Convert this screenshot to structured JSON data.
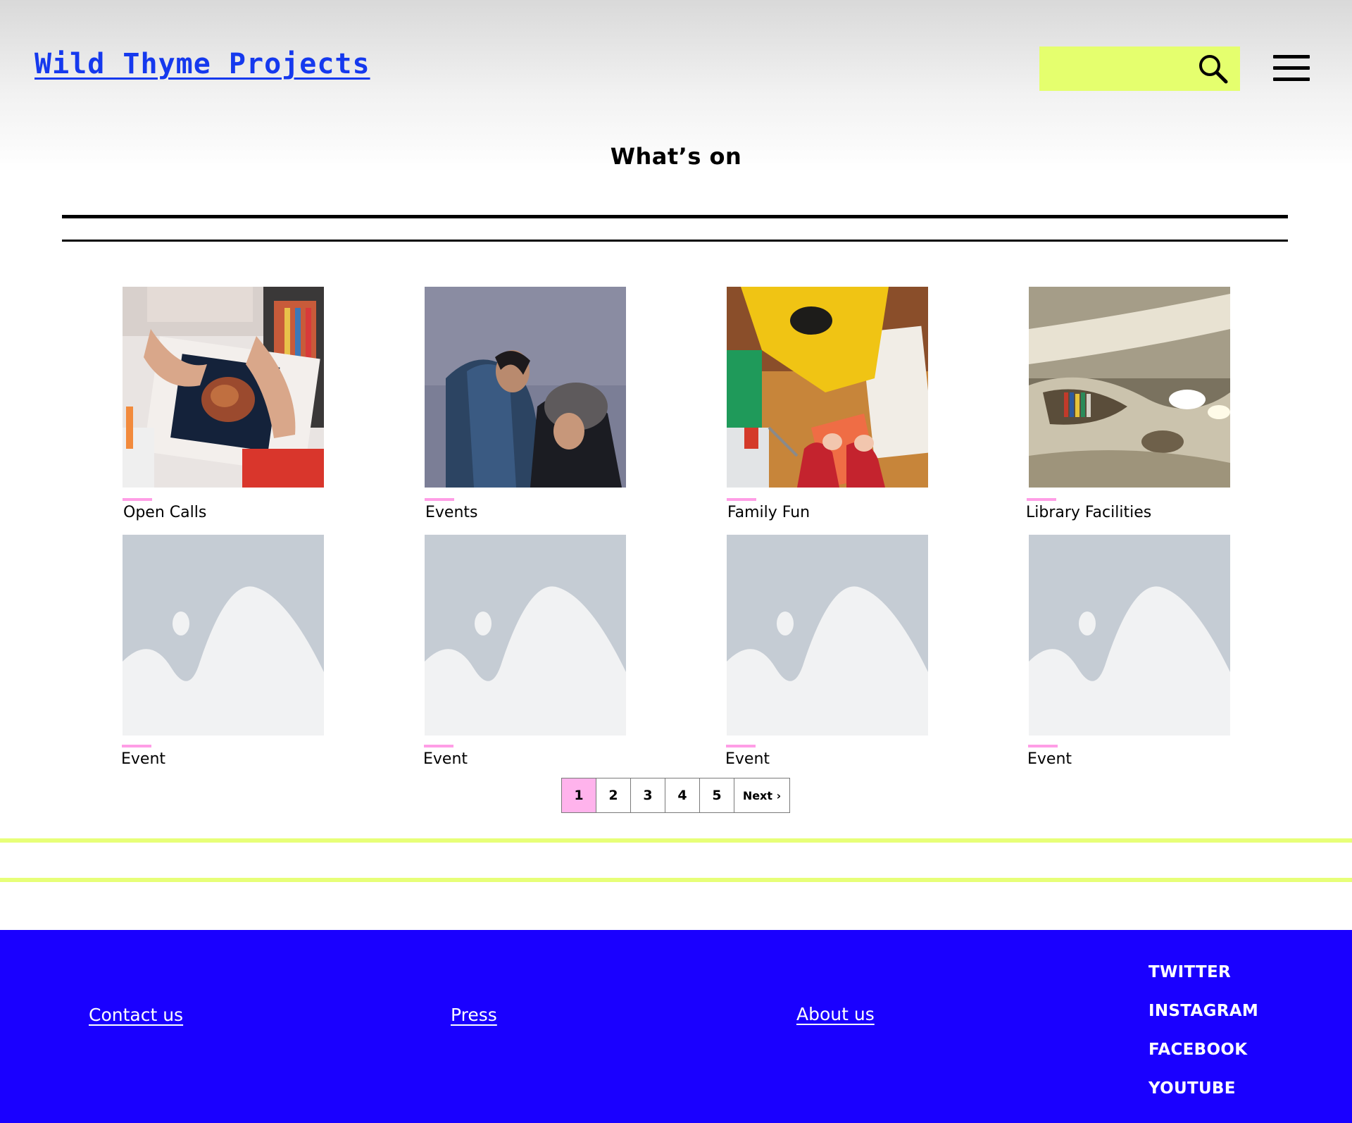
{
  "header": {
    "site_title": "Wild Thyme Projects",
    "search_icon": "search-icon",
    "menu_icon": "hamburger-menu-icon",
    "search_bg_color": "#e5ff6e",
    "title_color": "#1539ee"
  },
  "main": {
    "page_title": "What’s on",
    "cards": [
      {
        "label": "Open Calls",
        "image": "artist-painting-photo"
      },
      {
        "label": "Events",
        "image": "people-portrait-photo"
      },
      {
        "label": "Family Fun",
        "image": "child-crafts-photo"
      },
      {
        "label": "Library Facilities",
        "image": "curved-library-interior-photo"
      },
      {
        "label": "Event",
        "image": "placeholder-image-icon"
      },
      {
        "label": "Event",
        "image": "placeholder-image-icon"
      },
      {
        "label": "Event",
        "image": "placeholder-image-icon"
      },
      {
        "label": "Event",
        "image": "placeholder-image-icon"
      }
    ],
    "accent_color": "#ff9ee6"
  },
  "pagination": {
    "pages": [
      "1",
      "2",
      "3",
      "4",
      "5"
    ],
    "current": "1",
    "next_label": "Next ›"
  },
  "footer": {
    "bg_color": "#1a00ff",
    "links": [
      "Contact us",
      "Press",
      "About us"
    ],
    "social": [
      "TWITTER",
      "INSTAGRAM",
      "FACEBOOK",
      "YOUTUBE"
    ]
  }
}
